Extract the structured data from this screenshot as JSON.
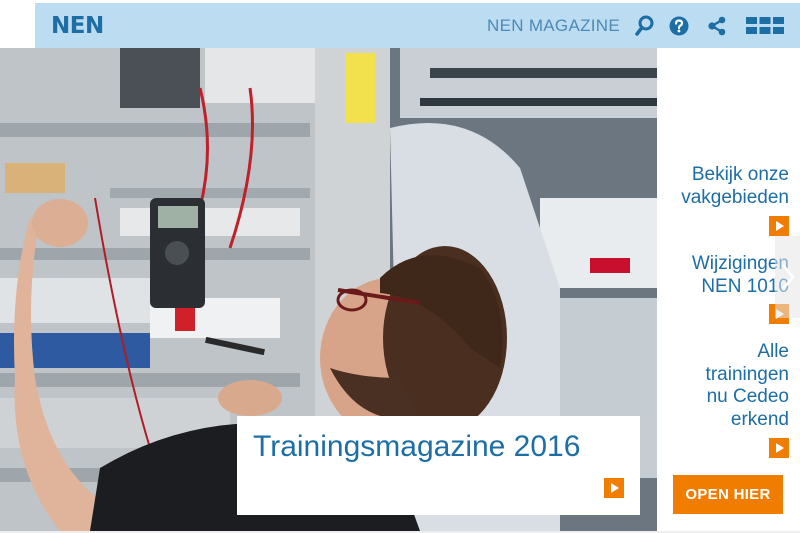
{
  "header": {
    "logo_text": "NEN",
    "magazine_label": "NEN MAGAZINE",
    "icons": [
      "search-icon",
      "help-icon",
      "share-icon",
      "grid-menu-icon"
    ]
  },
  "hero": {
    "caption_title": "Trainingsmagazine 2016"
  },
  "side_links": [
    {
      "label": "Bekijk onze vakgebieden"
    },
    {
      "label": "Wijzigingen NEN 1010"
    },
    {
      "label": "Alle trainingen nu Cedeo erkend"
    }
  ],
  "cta": {
    "label": "OPEN HIER"
  },
  "colors": {
    "brand_blue": "#1c6ea4",
    "header_bg": "#bcdcf1",
    "accent_orange": "#f07d00"
  }
}
